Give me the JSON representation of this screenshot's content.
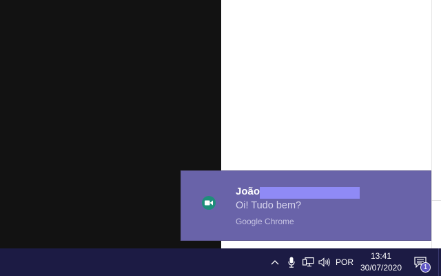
{
  "notification": {
    "sender": "João",
    "message": "Oi! Tudo bem?",
    "source": "Google Chrome",
    "app_icon": "google-meet-icon"
  },
  "taskbar": {
    "language": "POR",
    "time": "13:41",
    "date": "30/07/2020",
    "notification_count": "1",
    "icons": [
      "chevron-up-icon",
      "microphone-icon",
      "network-icon",
      "volume-icon",
      "action-center-icon"
    ]
  },
  "colors": {
    "toast_background": "#6963a9",
    "taskbar_background": "#1c1b44",
    "redaction": "#8f8af5"
  }
}
